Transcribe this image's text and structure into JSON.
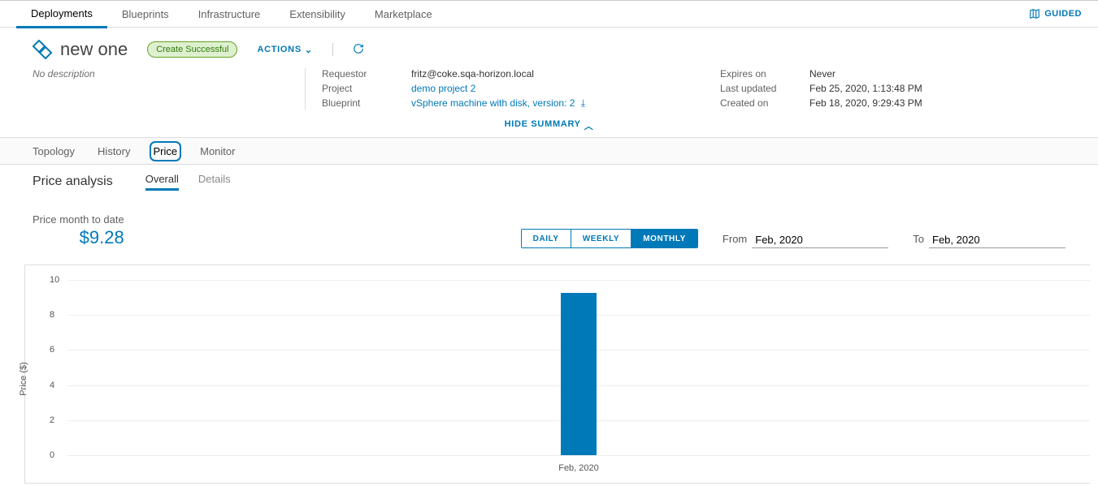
{
  "top_tabs": {
    "deployments": "Deployments",
    "blueprints": "Blueprints",
    "infrastructure": "Infrastructure",
    "extensibility": "Extensibility",
    "marketplace": "Marketplace"
  },
  "guided": "GUIDED",
  "title": "new one",
  "status_badge": "Create Successful",
  "actions_label": "ACTIONS",
  "no_description": "No description",
  "meta": {
    "requestor_lbl": "Requestor",
    "requestor": "fritz@coke.sqa-horizon.local",
    "project_lbl": "Project",
    "project": "demo project 2",
    "blueprint_lbl": "Blueprint",
    "blueprint": "vSphere machine with disk, version: 2",
    "expires_lbl": "Expires on",
    "expires": "Never",
    "updated_lbl": "Last updated",
    "updated": "Feb 25, 2020, 1:13:48 PM",
    "created_lbl": "Created on",
    "created": "Feb 18, 2020, 9:29:43 PM"
  },
  "hide_summary": "HIDE SUMMARY",
  "content_tabs": {
    "topology": "Topology",
    "history": "History",
    "price": "Price",
    "monitor": "Monitor"
  },
  "price_analysis": "Price analysis",
  "sub_tabs": {
    "overall": "Overall",
    "details": "Details"
  },
  "mtd_label": "Price month to date",
  "mtd_value": "$9.28",
  "granularity": {
    "daily": "DAILY",
    "weekly": "WEEKLY",
    "monthly": "MONTHLY"
  },
  "from_lbl": "From",
  "from_val": "Feb, 2020",
  "to_lbl": "To",
  "to_val": "Feb, 2020",
  "chart_data": {
    "type": "bar",
    "categories": [
      "Feb, 2020"
    ],
    "values": [
      9.28
    ],
    "title": "",
    "xlabel": "",
    "ylabel": "Price ($)",
    "ylim": [
      0,
      10
    ]
  }
}
